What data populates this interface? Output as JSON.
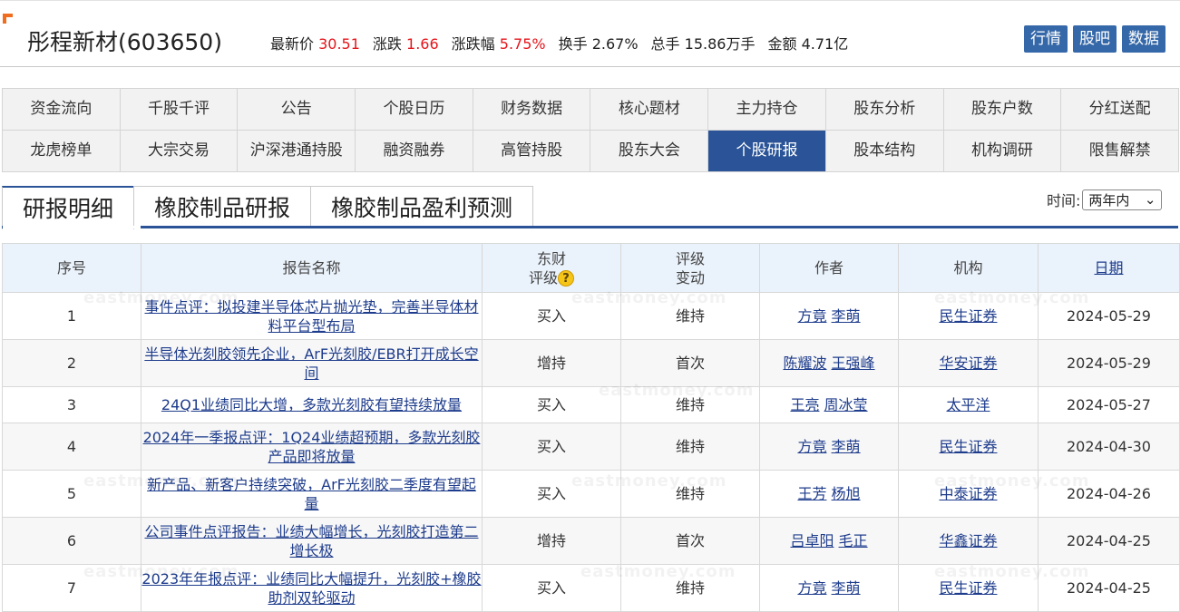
{
  "header": {
    "stock_title": "彤程新材(603650)",
    "quotes": [
      {
        "label": "最新价",
        "value": "30.51",
        "red": true
      },
      {
        "label": "涨跌",
        "value": "1.66",
        "red": true
      },
      {
        "label": "涨跌幅",
        "value": "5.75%",
        "red": true
      },
      {
        "label": "换手",
        "value": "2.67%",
        "red": false
      },
      {
        "label": "总手",
        "value": "15.86万手",
        "red": false
      },
      {
        "label": "金额",
        "value": "4.71亿",
        "red": false
      }
    ],
    "buttons": [
      "行情",
      "股吧",
      "数据"
    ]
  },
  "nav": {
    "items": [
      "资金流向",
      "千股千评",
      "公告",
      "个股日历",
      "财务数据",
      "核心题材",
      "主力持仓",
      "股东分析",
      "股东户数",
      "分红送配",
      "龙虎榜单",
      "大宗交易",
      "沪深港通持股",
      "融资融券",
      "高管持股",
      "股东大会",
      "个股研报",
      "股本结构",
      "机构调研",
      "限售解禁"
    ],
    "active_index": 16
  },
  "tabs": [
    "研报明细",
    "橡胶制品研报",
    "橡胶制品盈利预测"
  ],
  "time_filter": {
    "label": "时间:",
    "value": "两年内"
  },
  "watermark": "eastmoney.com",
  "table": {
    "headers": {
      "seq": "序号",
      "title": "报告名称",
      "rating_l1": "东财",
      "rating_l2": "评级",
      "change_l1": "评级",
      "change_l2": "变动",
      "authors": "作者",
      "institution": "机构",
      "date": "日期"
    },
    "rows": [
      {
        "seq": "1",
        "title": "事件点评：拟投建半导体芯片抛光垫，完善半导体材料平台型布局",
        "rating": "买入",
        "change": "维持",
        "authors": [
          "方竟",
          "李萌"
        ],
        "institution": "民生证券",
        "date": "2024-05-29"
      },
      {
        "seq": "2",
        "title": "半导体光刻胶领先企业，ArF光刻胶/EBR打开成长空间",
        "rating": "增持",
        "change": "首次",
        "authors": [
          "陈耀波",
          "王强峰"
        ],
        "institution": "华安证券",
        "date": "2024-05-29"
      },
      {
        "seq": "3",
        "title": "24Q1业绩同比大增，多款光刻胶有望持续放量",
        "rating": "买入",
        "change": "维持",
        "authors": [
          "王亮",
          "周冰莹"
        ],
        "institution": "太平洋",
        "date": "2024-05-27"
      },
      {
        "seq": "4",
        "title": "2024年一季报点评：1Q24业绩超预期，多款光刻胶产品即将放量",
        "rating": "买入",
        "change": "维持",
        "authors": [
          "方竟",
          "李萌"
        ],
        "institution": "民生证券",
        "date": "2024-04-30"
      },
      {
        "seq": "5",
        "title": "新产品、新客户持续突破，ArF光刻胶二季度有望起量",
        "rating": "买入",
        "change": "维持",
        "authors": [
          "王芳",
          "杨旭"
        ],
        "institution": "中泰证券",
        "date": "2024-04-26"
      },
      {
        "seq": "6",
        "title": "公司事件点评报告：业绩大幅增长，光刻胶打造第二增长极",
        "rating": "增持",
        "change": "首次",
        "authors": [
          "吕卓阳",
          "毛正"
        ],
        "institution": "华鑫证券",
        "date": "2024-04-25"
      },
      {
        "seq": "7",
        "title": "2023年年报点评：业绩同比大幅提升，光刻胶+橡胶助剂双轮驱动",
        "rating": "买入",
        "change": "维持",
        "authors": [
          "方竟",
          "李萌"
        ],
        "institution": "民生证券",
        "date": "2024-04-25"
      }
    ]
  }
}
